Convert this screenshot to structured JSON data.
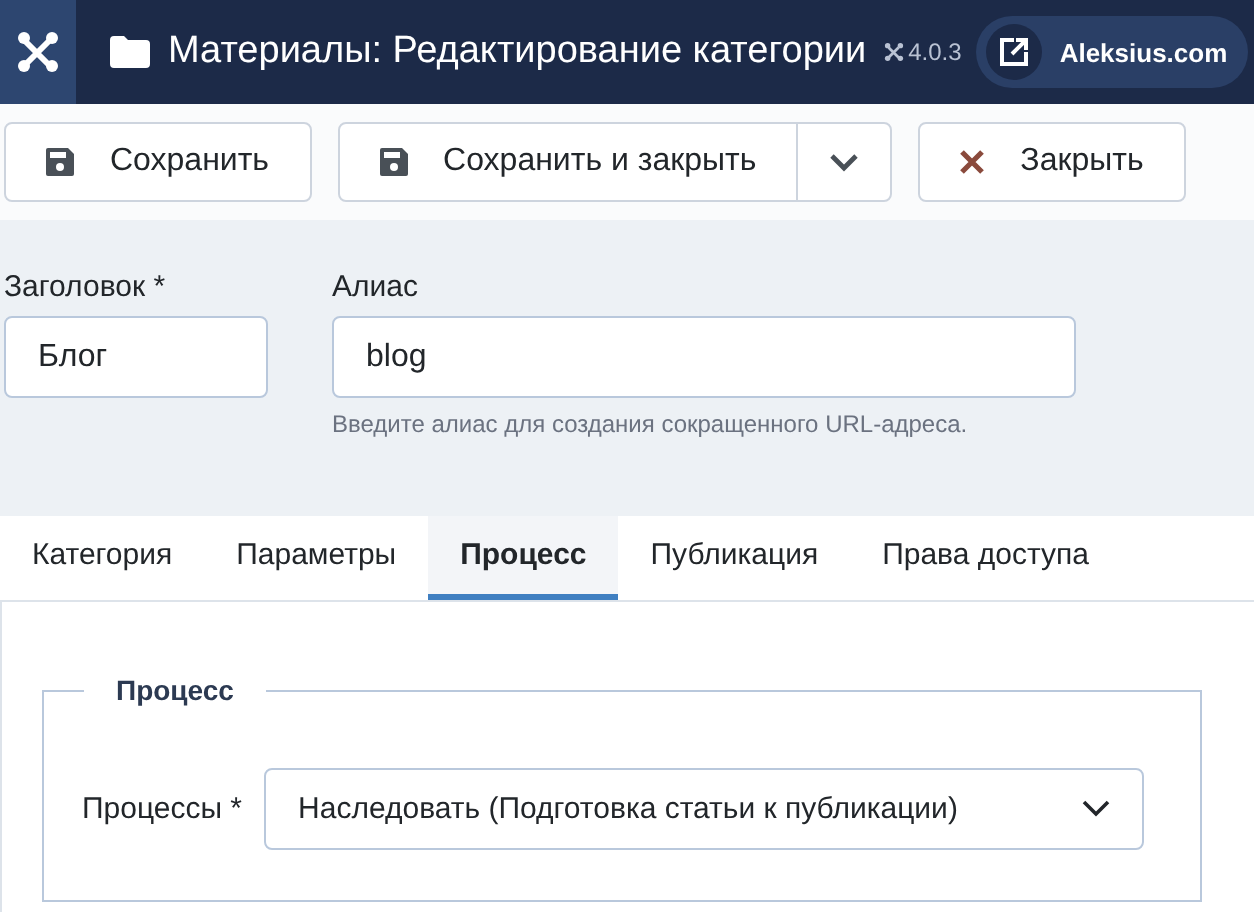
{
  "header": {
    "title": "Материалы: Редактирование категории",
    "version": "4.0.3",
    "site_link": "Aleksius.com"
  },
  "toolbar": [
    {
      "kind": "save",
      "label": "Сохранить"
    },
    {
      "kind": "save-split",
      "label": "Сохранить и закрыть"
    },
    {
      "kind": "close",
      "label": "Закрыть"
    }
  ],
  "fields": [
    {
      "label": "Заголовок *",
      "value": "Блог"
    },
    {
      "label": "Алиас",
      "value": "blog",
      "hint": "Введите алиас для создания сокращенного URL-адреса."
    }
  ],
  "tabs": [
    {
      "label": "Категория",
      "selected": false
    },
    {
      "label": "Параметры",
      "selected": false
    },
    {
      "label": "Процесс",
      "selected": true
    },
    {
      "label": "Публикация",
      "selected": false
    },
    {
      "label": "Права доступа",
      "selected": false
    }
  ],
  "fieldset": {
    "legend": "Процесс",
    "label": "Процессы *",
    "value": "Наследовать (Подготовка статьи к публикации)"
  }
}
